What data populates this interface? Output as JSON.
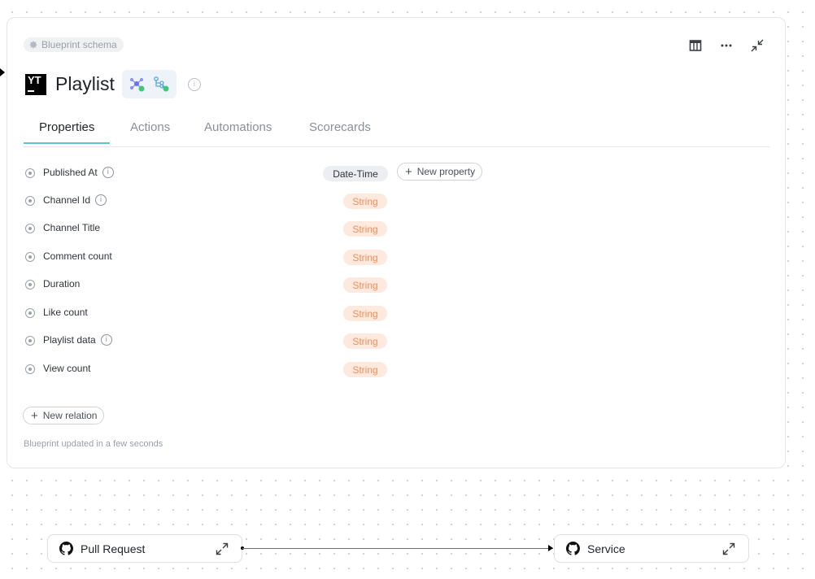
{
  "card": {
    "schema_chip": "Blueprint schema",
    "title": "Playlist",
    "logo_text": "YT",
    "updated_text": "Blueprint updated in a few seconds"
  },
  "tabs": [
    "Properties",
    "Actions",
    "Automations",
    "Scorecards"
  ],
  "properties": [
    {
      "name": "Published At",
      "type": "Date-Time",
      "has_info": true
    },
    {
      "name": "Channel Id",
      "type": "String",
      "has_info": true
    },
    {
      "name": "Channel Title",
      "type": "String",
      "has_info": false
    },
    {
      "name": "Comment count",
      "type": "String",
      "has_info": false
    },
    {
      "name": "Duration",
      "type": "String",
      "has_info": false
    },
    {
      "name": "Like count",
      "type": "String",
      "has_info": false
    },
    {
      "name": "Playlist data",
      "type": "String",
      "has_info": true
    },
    {
      "name": "View count",
      "type": "String",
      "has_info": false
    }
  ],
  "buttons": {
    "new_property": "New property",
    "new_relation": "New relation"
  },
  "icons": {
    "top_actions": [
      "table-icon",
      "more-icon",
      "collapse-icon"
    ]
  },
  "nodes": [
    {
      "label": "Pull Request",
      "icon": "github-icon"
    },
    {
      "label": "Service",
      "icon": "github-icon"
    }
  ],
  "colors": {
    "tab_underline": "#5fc4cf",
    "string_badge_bg": "#fde9de",
    "string_badge_text": "#ef8f5c"
  }
}
